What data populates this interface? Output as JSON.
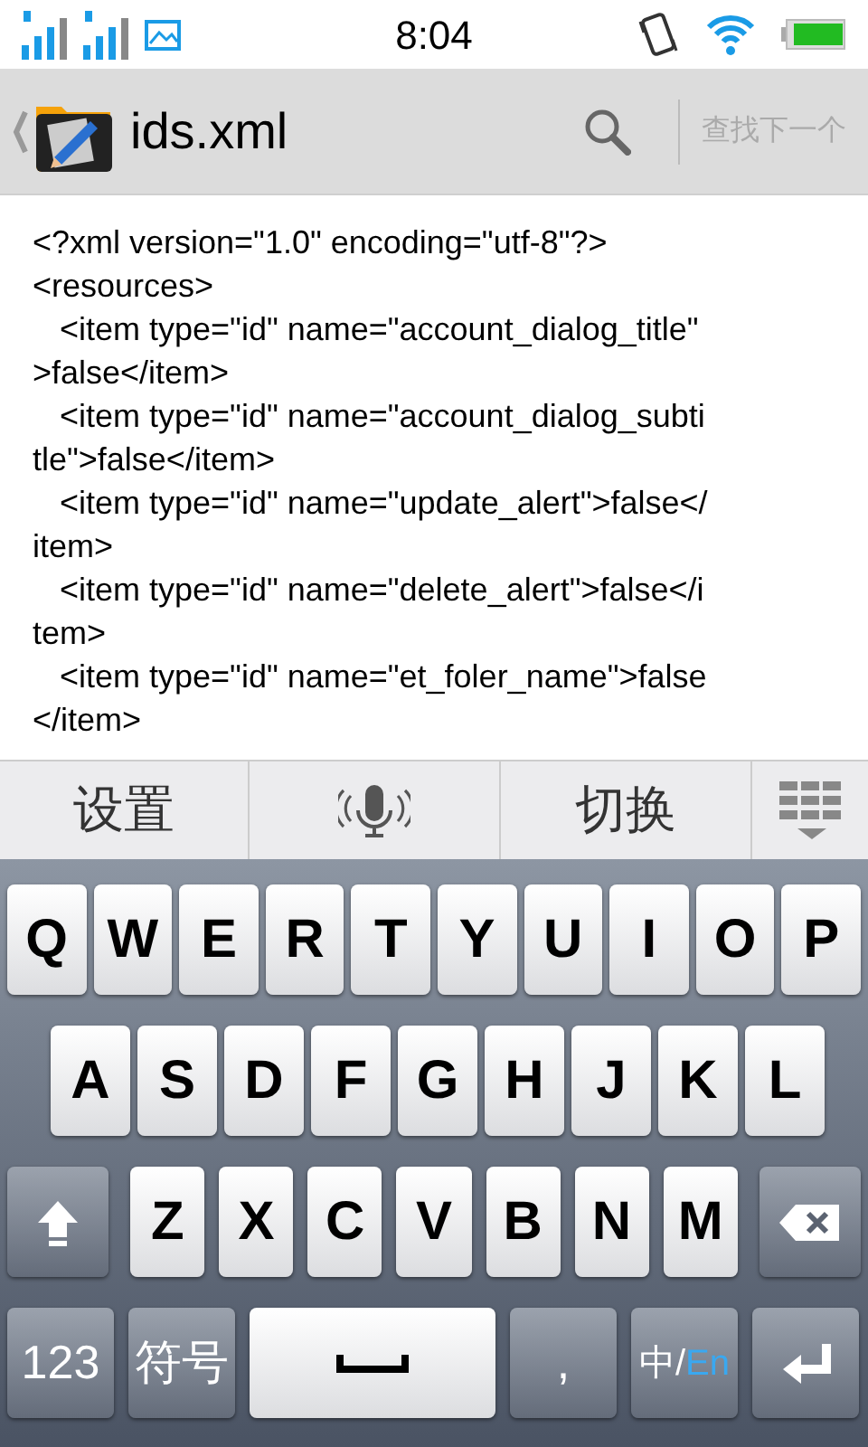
{
  "status_bar": {
    "time": "8:04"
  },
  "title_bar": {
    "title": "ids.xml",
    "find_next": "查找下一个"
  },
  "editor": {
    "lines": [
      "<?xml version=\"1.0\" encoding=\"utf-8\"?>",
      "<resources>",
      "   <item type=\"id\" name=\"account_dialog_title\"",
      ">false</item>",
      "   <item type=\"id\" name=\"account_dialog_subti",
      "tle\">false</item>",
      "   <item type=\"id\" name=\"update_alert\">false</",
      "item>",
      "   <item type=\"id\" name=\"delete_alert\">false</i",
      "tem>",
      "   <item type=\"id\" name=\"et_foler_name\">false",
      "</item>"
    ]
  },
  "candidate_bar": [
    {
      "kind": "text",
      "label": "设置"
    },
    {
      "kind": "mic"
    },
    {
      "kind": "text",
      "label": "切换"
    },
    {
      "kind": "grid"
    }
  ],
  "keyboard": {
    "rows": [
      {
        "keys": [
          {
            "kind": "letter",
            "label": "Q"
          },
          {
            "kind": "letter",
            "label": "W"
          },
          {
            "kind": "letter",
            "label": "E"
          },
          {
            "kind": "letter",
            "label": "R"
          },
          {
            "kind": "letter",
            "label": "T"
          },
          {
            "kind": "letter",
            "label": "Y"
          },
          {
            "kind": "letter",
            "label": "U"
          },
          {
            "kind": "letter",
            "label": "I"
          },
          {
            "kind": "letter",
            "label": "O"
          },
          {
            "kind": "letter",
            "label": "P"
          }
        ]
      },
      {
        "keys": [
          {
            "kind": "letter",
            "label": "A"
          },
          {
            "kind": "letter",
            "label": "S"
          },
          {
            "kind": "letter",
            "label": "D"
          },
          {
            "kind": "letter",
            "label": "F"
          },
          {
            "kind": "letter",
            "label": "G"
          },
          {
            "kind": "letter",
            "label": "H"
          },
          {
            "kind": "letter",
            "label": "J"
          },
          {
            "kind": "letter",
            "label": "K"
          },
          {
            "kind": "letter",
            "label": "L"
          }
        ]
      },
      {
        "keys": [
          {
            "kind": "shift"
          },
          {
            "kind": "letter",
            "label": "Z"
          },
          {
            "kind": "letter",
            "label": "X"
          },
          {
            "kind": "letter",
            "label": "C"
          },
          {
            "kind": "letter",
            "label": "V"
          },
          {
            "kind": "letter",
            "label": "B"
          },
          {
            "kind": "letter",
            "label": "N"
          },
          {
            "kind": "letter",
            "label": "M"
          },
          {
            "kind": "backspace"
          }
        ]
      },
      {
        "keys": [
          {
            "kind": "func",
            "label": "123"
          },
          {
            "kind": "func",
            "label": "符号"
          },
          {
            "kind": "space"
          },
          {
            "kind": "func",
            "label": ","
          },
          {
            "kind": "lang",
            "parts": [
              {
                "text": "中",
                "selected": false
              },
              {
                "text": "/",
                "selected": false
              },
              {
                "text": "En",
                "selected": true
              }
            ]
          },
          {
            "kind": "enter"
          }
        ]
      }
    ]
  }
}
